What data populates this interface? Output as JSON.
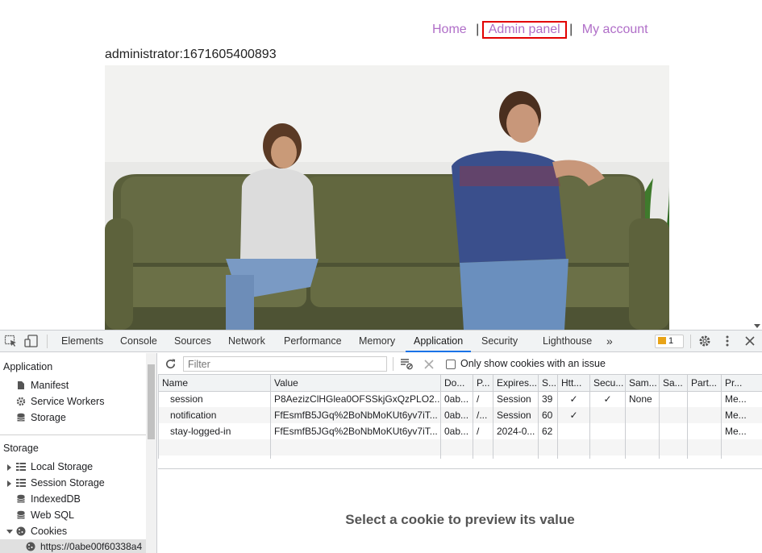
{
  "site": {
    "nav": {
      "home": "Home",
      "sep": "|",
      "admin": "Admin panel",
      "account": "My account"
    },
    "user_line": "administrator:1671605400893",
    "hero_image": "couple-on-couch-photo"
  },
  "devtools": {
    "tabs": [
      "Elements",
      "Console",
      "Sources",
      "Network",
      "Performance",
      "Memory",
      "Application",
      "Security",
      "Lighthouse"
    ],
    "active_tab": "Application",
    "more_tabs": "»",
    "issues_count": "1",
    "sidebar": {
      "app_header": "Application",
      "app_items": [
        "Manifest",
        "Service Workers",
        "Storage"
      ],
      "storage_header": "Storage",
      "storage_items": [
        "Local Storage",
        "Session Storage",
        "IndexedDB",
        "Web SQL",
        "Cookies"
      ],
      "cookie_origin": "https://0abe00f60338a4"
    },
    "toolbar": {
      "filter_placeholder": "Filter",
      "only_issues_label": "Only show cookies with an issue"
    },
    "columns": [
      "Name",
      "Value",
      "Do...",
      "P...",
      "Expires...",
      "S...",
      "Htt...",
      "Secu...",
      "Sam...",
      "Sa...",
      "Part...",
      "Pr..."
    ],
    "rows": [
      [
        "session",
        "P8AezizClHGlea0OFSSkjGxQzPLO2...",
        "0ab...",
        "/",
        "Session",
        "39",
        "✓",
        "✓",
        "None",
        "",
        "",
        "Me..."
      ],
      [
        "notification",
        "FfEsmfB5JGq%2BoNbMoKUt6yv7iT...",
        "0ab...",
        "/...",
        "Session",
        "60",
        "✓",
        "",
        "",
        "",
        "",
        "Me..."
      ],
      [
        "stay-logged-in",
        "FfEsmfB5JGq%2BoNbMoKUt6yv7iT...",
        "0ab...",
        "/",
        "2024-0...",
        "62",
        "",
        "",
        "",
        "",
        "",
        "Me..."
      ]
    ],
    "preview_text": "Select a cookie to preview its value",
    "colors": {
      "accent": "#1a73e8",
      "link": "#b06ec8",
      "highlight": "#e20000"
    }
  }
}
